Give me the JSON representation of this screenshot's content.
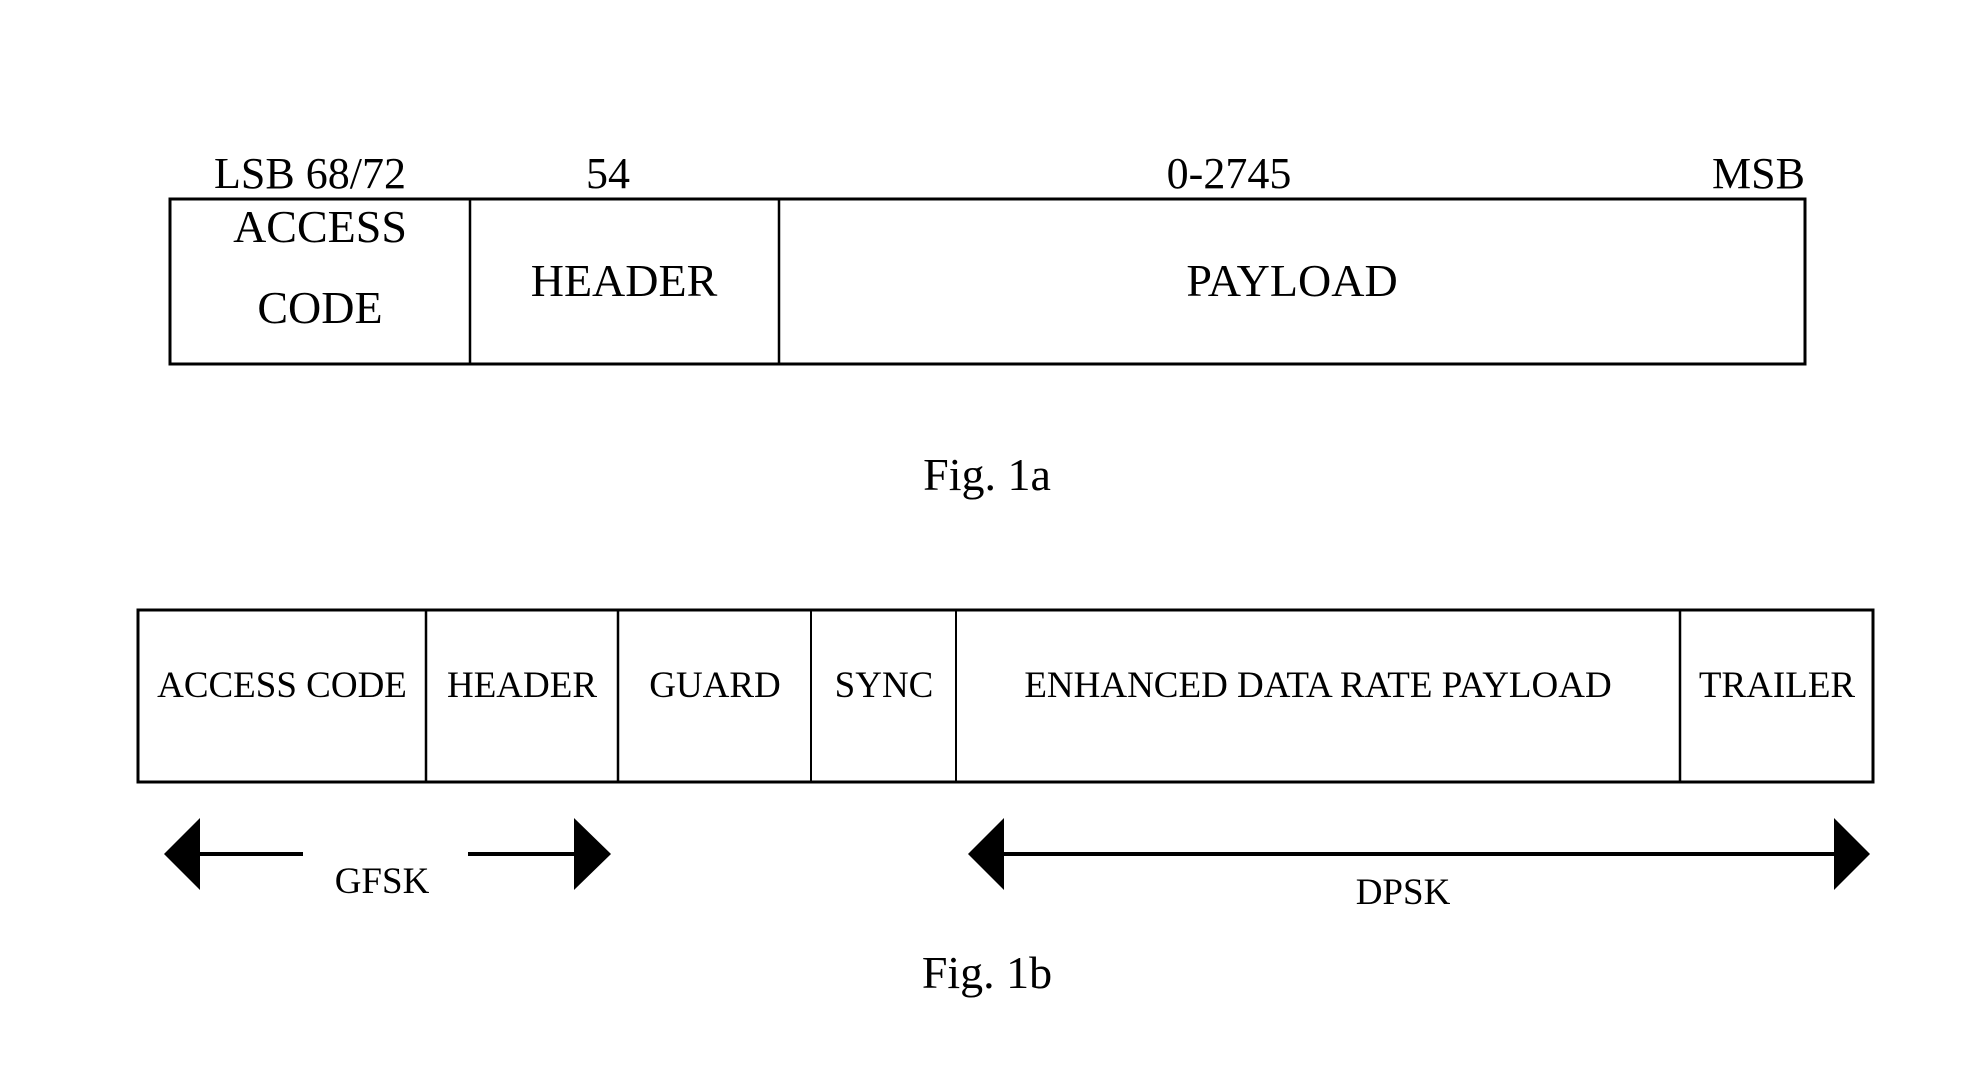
{
  "fig1a": {
    "caption": "Fig. 1a",
    "top_labels": [
      "LSB 68/72",
      "54",
      "0-2745",
      "MSB"
    ],
    "fields": [
      {
        "lines": [
          "ACCESS",
          "CODE"
        ]
      },
      {
        "lines": [
          "HEADER"
        ]
      },
      {
        "lines": [
          "PAYLOAD"
        ]
      }
    ]
  },
  "fig1b": {
    "caption": "Fig. 1b",
    "fields": [
      {
        "label": "ACCESS CODE"
      },
      {
        "label": "HEADER"
      },
      {
        "label": "GUARD"
      },
      {
        "label": "SYNC"
      },
      {
        "label": "ENHANCED DATA RATE PAYLOAD"
      },
      {
        "label": "TRAILER"
      }
    ],
    "modulation": [
      {
        "label": "GFSK",
        "spans_fields": [
          "ACCESS CODE",
          "HEADER"
        ]
      },
      {
        "label": "DPSK",
        "spans_fields": [
          "ENHANCED DATA RATE PAYLOAD",
          "TRAILER"
        ]
      }
    ]
  }
}
